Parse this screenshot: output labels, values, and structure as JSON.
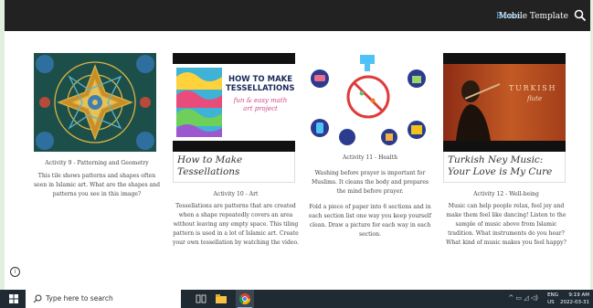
{
  "nav": {
    "home": "Home",
    "mobile": "Mobile Template"
  },
  "cards": [
    {
      "caption_title": "Activity 9 - Patterning and Geometry",
      "body": "This tile shows patterns and shapes often seen in Islamic art. What are the shapes and patterns you see in this image?"
    },
    {
      "title": "How to Make Tessellations",
      "caption_title": "Activity 10 - Art",
      "body": "Tessellations are patterns that are created when a shape repeatedly covers an area without leaving any empty space. This tiling pattern is used in a lot of Islamic art.  Create your own tessellation by watching the video.",
      "thumb_title": "HOW TO MAKE TESSELLATIONS!",
      "thumb_sub": "fun & easy math art project"
    },
    {
      "caption_title": "Activity 11 - Health",
      "body1": "Washing before prayer is important for Muslims. It cleans the body and prepares the mind before prayer.",
      "body2": "Fold a piece of paper into 6 sections and in each section list one way you keep yourself clean.  Draw a picture for each way in each section."
    },
    {
      "title": "Turkish Ney Music: Your Love is My Cure",
      "caption_title": "Activity 12 - Well-being",
      "body": "Music can help people relax, feel joy and make them feel like dancing! Listen to the sample of music above from Islamic tradition. What instruments do you hear?  What kind of music makes you feel happy?",
      "thumb_title": "TURKISH",
      "thumb_sub": "flute"
    }
  ],
  "taskbar": {
    "search_placeholder": "Type here to search",
    "lang": "ENG",
    "region": "US",
    "time": "9:19 AM",
    "date": "2022-03-31"
  }
}
